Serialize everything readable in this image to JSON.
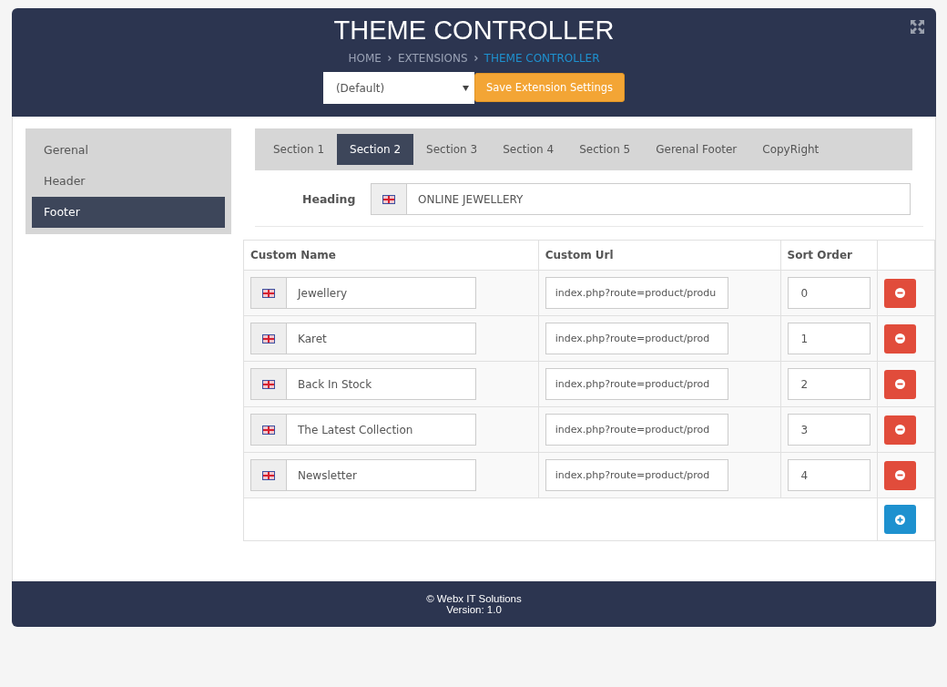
{
  "header": {
    "title": "THEME CONTROLLER",
    "breadcrumb": [
      {
        "label": "HOME",
        "current": false
      },
      {
        "label": "EXTENSIONS",
        "current": false
      },
      {
        "label": "THEME CONTROLLER",
        "current": true
      }
    ],
    "store_select": {
      "value": "(Default)"
    },
    "save_button": "Save Extension Settings"
  },
  "sidebar": {
    "items": [
      {
        "label": "Gerenal",
        "selected": false
      },
      {
        "label": "Header",
        "selected": false
      },
      {
        "label": "Footer",
        "selected": true
      }
    ]
  },
  "tabs": [
    {
      "label": "Section 1",
      "selected": false
    },
    {
      "label": "Section 2",
      "selected": true
    },
    {
      "label": "Section 3",
      "selected": false
    },
    {
      "label": "Section 4",
      "selected": false
    },
    {
      "label": "Section 5",
      "selected": false
    },
    {
      "label": "Gerenal Footer",
      "selected": false
    },
    {
      "label": "CopyRight",
      "selected": false
    }
  ],
  "heading": {
    "label": "Heading",
    "value": "ONLINE JEWELLERY"
  },
  "table": {
    "columns": [
      "Custom Name",
      "Custom Url",
      "Sort Order"
    ],
    "rows": [
      {
        "name": "Jewellery",
        "url": "index.php?route=product/produ",
        "sort": "0"
      },
      {
        "name": "Karet",
        "url": "index.php?route=product/prod",
        "sort": "1"
      },
      {
        "name": "Back In Stock",
        "url": "index.php?route=product/prod",
        "sort": "2"
      },
      {
        "name": "The Latest Collection",
        "url": "index.php?route=product/prod",
        "sort": "3"
      },
      {
        "name": "Newsletter",
        "url": "index.php?route=product/prod",
        "sort": "4"
      }
    ]
  },
  "footer": {
    "copyright": "© Webx IT Solutions",
    "version": "Version: 1.0"
  }
}
